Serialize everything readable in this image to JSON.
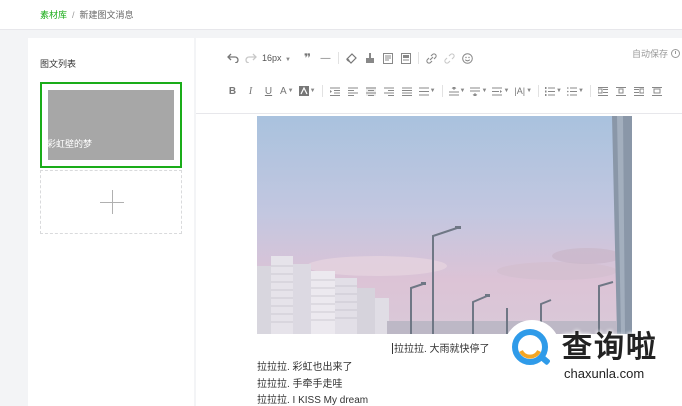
{
  "breadcrumb": {
    "root": "素材库",
    "separator": "/",
    "current": "新建图文消息"
  },
  "left_panel": {
    "title": "图文列表",
    "cards": [
      {
        "caption": "彩虹壁的梦"
      }
    ],
    "add_icon": "plus-icon"
  },
  "toolbar": {
    "font_size": "16px",
    "autosave_label": "自动保存",
    "row1_icons": [
      "undo-icon",
      "redo-icon",
      "font-size-select",
      "blockquote-icon",
      "horizontal-rule-icon",
      "eraser-icon",
      "format-brush-icon",
      "template-icon",
      "card-icon",
      "link-icon",
      "unlink-icon",
      "emoji-icon"
    ],
    "row2_icons": [
      "bold-icon",
      "italic-icon",
      "underline-icon",
      "font-color-icon",
      "background-color-icon",
      "indent-icon",
      "align-left-icon",
      "align-center-icon",
      "align-right-icon",
      "align-justify-icon",
      "line-height-icon",
      "paragraph-spacing-before-icon",
      "paragraph-spacing-after-icon",
      "letter-spacing-icon",
      "text-direction-icon",
      "ordered-list-icon",
      "unordered-list-icon",
      "float-left-icon",
      "float-none-icon",
      "float-right-icon",
      "float-center-icon"
    ]
  },
  "content": {
    "lines": [
      "拉拉拉. 大雨就快停了",
      "拉拉拉. 彩虹也出来了",
      "拉拉拉. 手牵手走哇",
      "拉拉拉. I KISS My dream"
    ]
  },
  "watermark": {
    "text": "查询啦",
    "url": "chaxunla.com"
  },
  "colors": {
    "accent": "#1aad19",
    "card_thumb": "#a7a7a7",
    "page_bg": "#f3f4f6"
  }
}
